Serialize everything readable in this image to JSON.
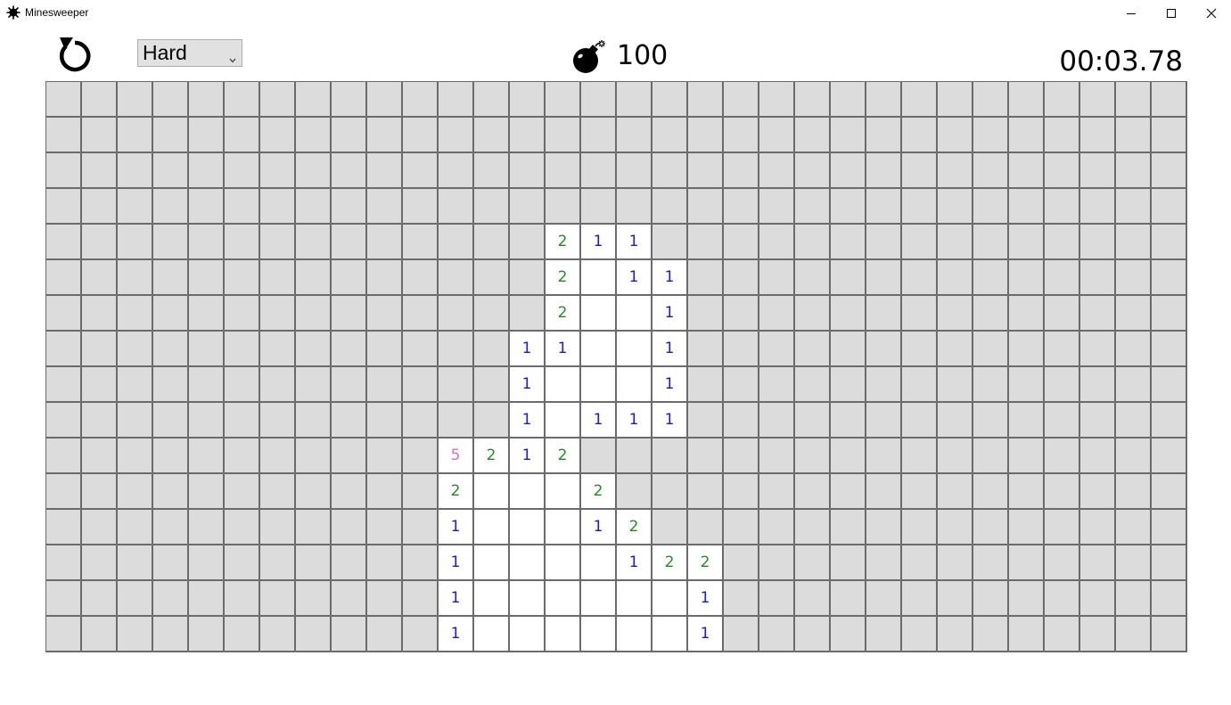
{
  "window": {
    "title": "Minesweeper",
    "app_icon": "mine-icon",
    "controls": [
      "minimize-icon",
      "maximize-icon",
      "close-icon"
    ]
  },
  "toolbar": {
    "reset_icon": "restart-arrow-icon",
    "difficulty": {
      "selected": "Hard"
    },
    "mine_counter": {
      "icon": "bomb-icon",
      "value": "100"
    },
    "timer": "00:03.78"
  },
  "colors": {
    "unrevealed": "#dcdcdc",
    "revealed": "#ffffff",
    "grid_line": "#6b6b6b",
    "number_1": "#1c1ccc",
    "number_2": "#228b22",
    "number_5": "#d070c8"
  },
  "board": {
    "columns": 32,
    "row_count": 16,
    "legend": "# = unrevealed, . = revealed empty, digit = revealed number",
    "rows": [
      "################################",
      "################################",
      "################################",
      "################################",
      "##############211###############",
      "##############2.11##############",
      "##############2..1##############",
      "#############11..1##############",
      "#############1...1##############",
      "#############1.111##############",
      "###########5212#################",
      "###########2...2################",
      "###########1...12###############",
      "###########1....122#############",
      "###########1......1#############",
      "###########1......1#############"
    ]
  }
}
